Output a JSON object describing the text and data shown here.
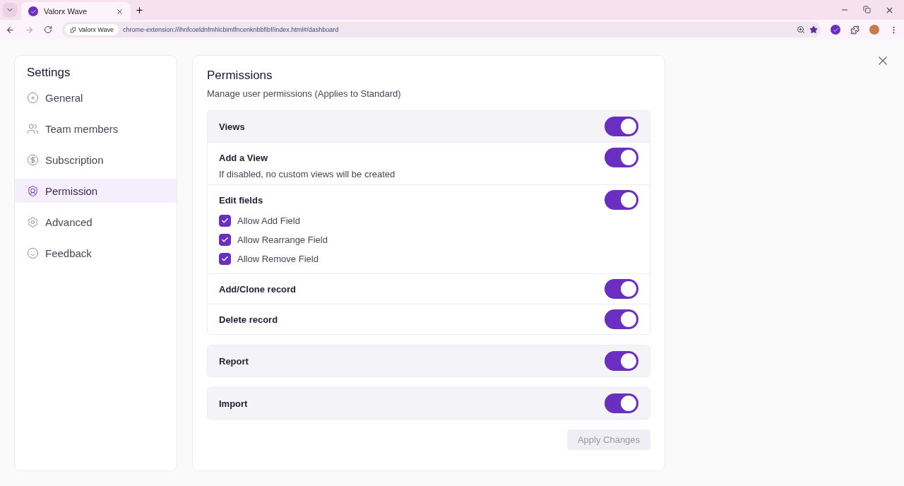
{
  "browser": {
    "tab_title": "Valorx Wave",
    "site_chip": "Valorx Wave",
    "url": "chrome-extension://ihnfcoeldnfmhlcbimlfncenknbbfibf/index.html#/dashboard"
  },
  "sidebar": {
    "title": "Settings",
    "items": [
      {
        "label": "General",
        "selected": false
      },
      {
        "label": "Team members",
        "selected": false
      },
      {
        "label": "Subscription",
        "selected": false
      },
      {
        "label": "Permission",
        "selected": true
      },
      {
        "label": "Advanced",
        "selected": false
      },
      {
        "label": "Feedback",
        "selected": false
      }
    ]
  },
  "panel": {
    "title": "Permissions",
    "subtitle": "Manage user permissions (Applies to Standard)",
    "groups": [
      {
        "label": "Views",
        "on": true,
        "children": [
          {
            "label": "Add a View",
            "on": true,
            "description": "If disabled, no custom views will be created"
          },
          {
            "label": "Edit fields",
            "on": true,
            "options": [
              {
                "label": "Allow Add Field",
                "checked": true
              },
              {
                "label": "Allow Rearrange Field",
                "checked": true
              },
              {
                "label": "Allow Remove Field",
                "checked": true
              }
            ]
          },
          {
            "label": "Add/Clone record",
            "on": true
          },
          {
            "label": "Delete record",
            "on": true
          }
        ]
      },
      {
        "label": "Report",
        "on": true
      },
      {
        "label": "Import",
        "on": true
      }
    ],
    "apply_button": {
      "label": "Apply Changes",
      "disabled": true
    }
  }
}
